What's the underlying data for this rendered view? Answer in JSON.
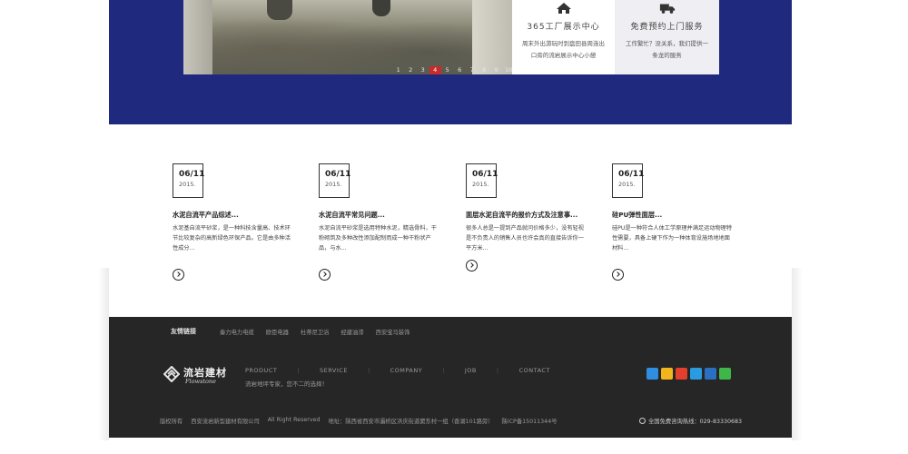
{
  "hero": {
    "pager": [
      "1",
      "2",
      "3",
      "4",
      "5",
      "6",
      "7",
      "8",
      "9",
      "10"
    ],
    "active_page": "4",
    "cards": [
      {
        "icon": "house-icon",
        "title": "365工厂展示中心",
        "desc": "周末外出游玩时到盘田县周连出口旁的流岩展示中心小憩"
      },
      {
        "icon": "truck-icon",
        "title": "免费预约上门服务",
        "desc": "工作繁忙？没关系，我们提供一条龙的服务"
      }
    ]
  },
  "news": [
    {
      "date": "06/11",
      "year": "2015.",
      "title": "水泥自流平产品综述...",
      "summary": "水泥基自流平砂浆，是一种科技含量高、技术环节比较复杂的高新绿色环保产品。它是由多种活性成分..."
    },
    {
      "date": "06/11",
      "year": "2015.",
      "title": "水泥自流平常见问题...",
      "summary": "水泥自流平砂浆是选用特种水泥，精选骨料，干粉砌筑及多种改性添加配制而成一种干粉状产品，与水..."
    },
    {
      "date": "06/11",
      "year": "2015.",
      "title": "面层水泥自流平的报价方式及注意事...",
      "summary": "很多人总是一提到产品就问价格多少，没有轻视是不负责人的销售人员也许会真的直接告诉你一平方米..."
    },
    {
      "date": "06/11",
      "year": "2015.",
      "title": "硅PU弹性面层...",
      "summary": "硅PU是一种符合人体工学原理并满足运动物理特性需要，具备上硬下作为一种体育设施场地地面材料..."
    }
  ],
  "footer": {
    "links_label": "友情链接",
    "links": [
      "秦力电力电缆",
      "欧臣电器",
      "杜蒂尼卫浴",
      "经建油漆",
      "西安宝马装饰"
    ],
    "logo_cn": "流岩建材",
    "logo_en": "Flowstone",
    "nav": [
      "PRODUCT",
      "SERVICE",
      "COMPANY",
      "JOB",
      "CONTACT"
    ],
    "tagline": "流岩地坪专家，您不二的选择！",
    "copyright": [
      "版权所有",
      "西安流岩新型建材有限公司",
      "All Right Reserved",
      "地址：陕西省西安市灞桥区洪庆街道窦东村一组（香湖101路旁）",
      "陕ICP备15011344号"
    ],
    "hotline": "全国免费咨询热线：029-83330683",
    "social": [
      {
        "name": "qzone-share-icon",
        "color": "#2f8ee0"
      },
      {
        "name": "favorite-star-icon",
        "color": "#f3b51c"
      },
      {
        "name": "weibo-icon",
        "color": "#e2402d"
      },
      {
        "name": "qq-icon",
        "color": "#2b9be0"
      },
      {
        "name": "renren-icon",
        "color": "#2a6fc1"
      },
      {
        "name": "wechat-icon",
        "color": "#3fb64a"
      }
    ]
  }
}
